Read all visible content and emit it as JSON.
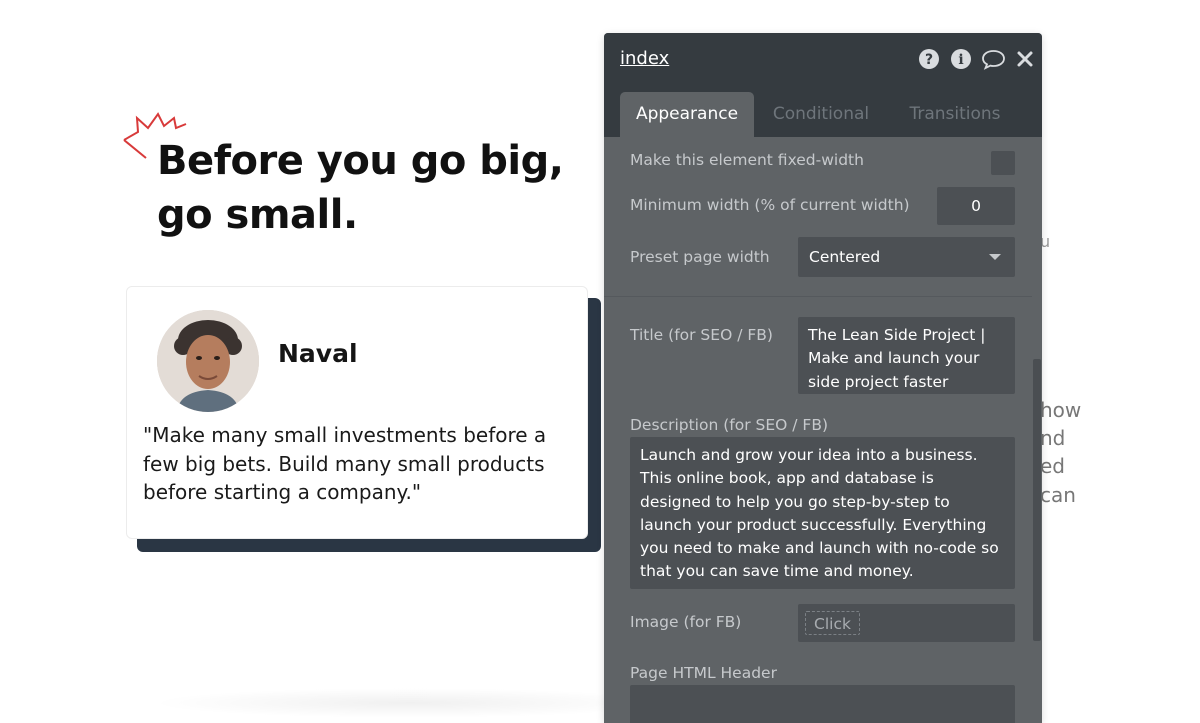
{
  "page": {
    "headline_line1": "Before you go big,",
    "headline_line2": "go small.",
    "quote_card": {
      "author": "Naval",
      "quote": "\"Make many small investments before a few big bets. Build many small products before starting a company.\""
    },
    "background_fragments": [
      "u",
      "how",
      "nd",
      "ed",
      "can"
    ]
  },
  "panel": {
    "title": "index",
    "icons": [
      "help-icon",
      "info-icon",
      "comment-icon",
      "close-icon"
    ],
    "tabs": [
      {
        "label": "Appearance",
        "active": true
      },
      {
        "label": "Conditional",
        "active": false
      },
      {
        "label": "Transitions",
        "active": false
      }
    ],
    "fixed_width": {
      "label": "Make this element fixed-width",
      "checked": false
    },
    "min_width": {
      "label": "Minimum width (% of current width)",
      "value": "0"
    },
    "preset_width": {
      "label": "Preset page width",
      "value": "Centered"
    },
    "seo_title": {
      "label": "Title (for SEO / FB)",
      "value": "The Lean Side Project | Make and launch your side project faster"
    },
    "seo_description": {
      "label": "Description (for SEO / FB)",
      "value": "Launch and grow your idea into a business. This online book, app and database is designed to help you go step-by-step to launch your product successfully. Everything you need to make and launch with no-code so that you can save time and money."
    },
    "image": {
      "label": "Image (for FB)",
      "button": "Click"
    },
    "html_header": {
      "label": "Page HTML Header"
    }
  },
  "colors": {
    "panel_bg": "#5f6366",
    "panel_header": "#353b40",
    "field_bg": "#4c5054",
    "card_shadow": "#2a3644",
    "accent_spark": "#d83a3a"
  }
}
